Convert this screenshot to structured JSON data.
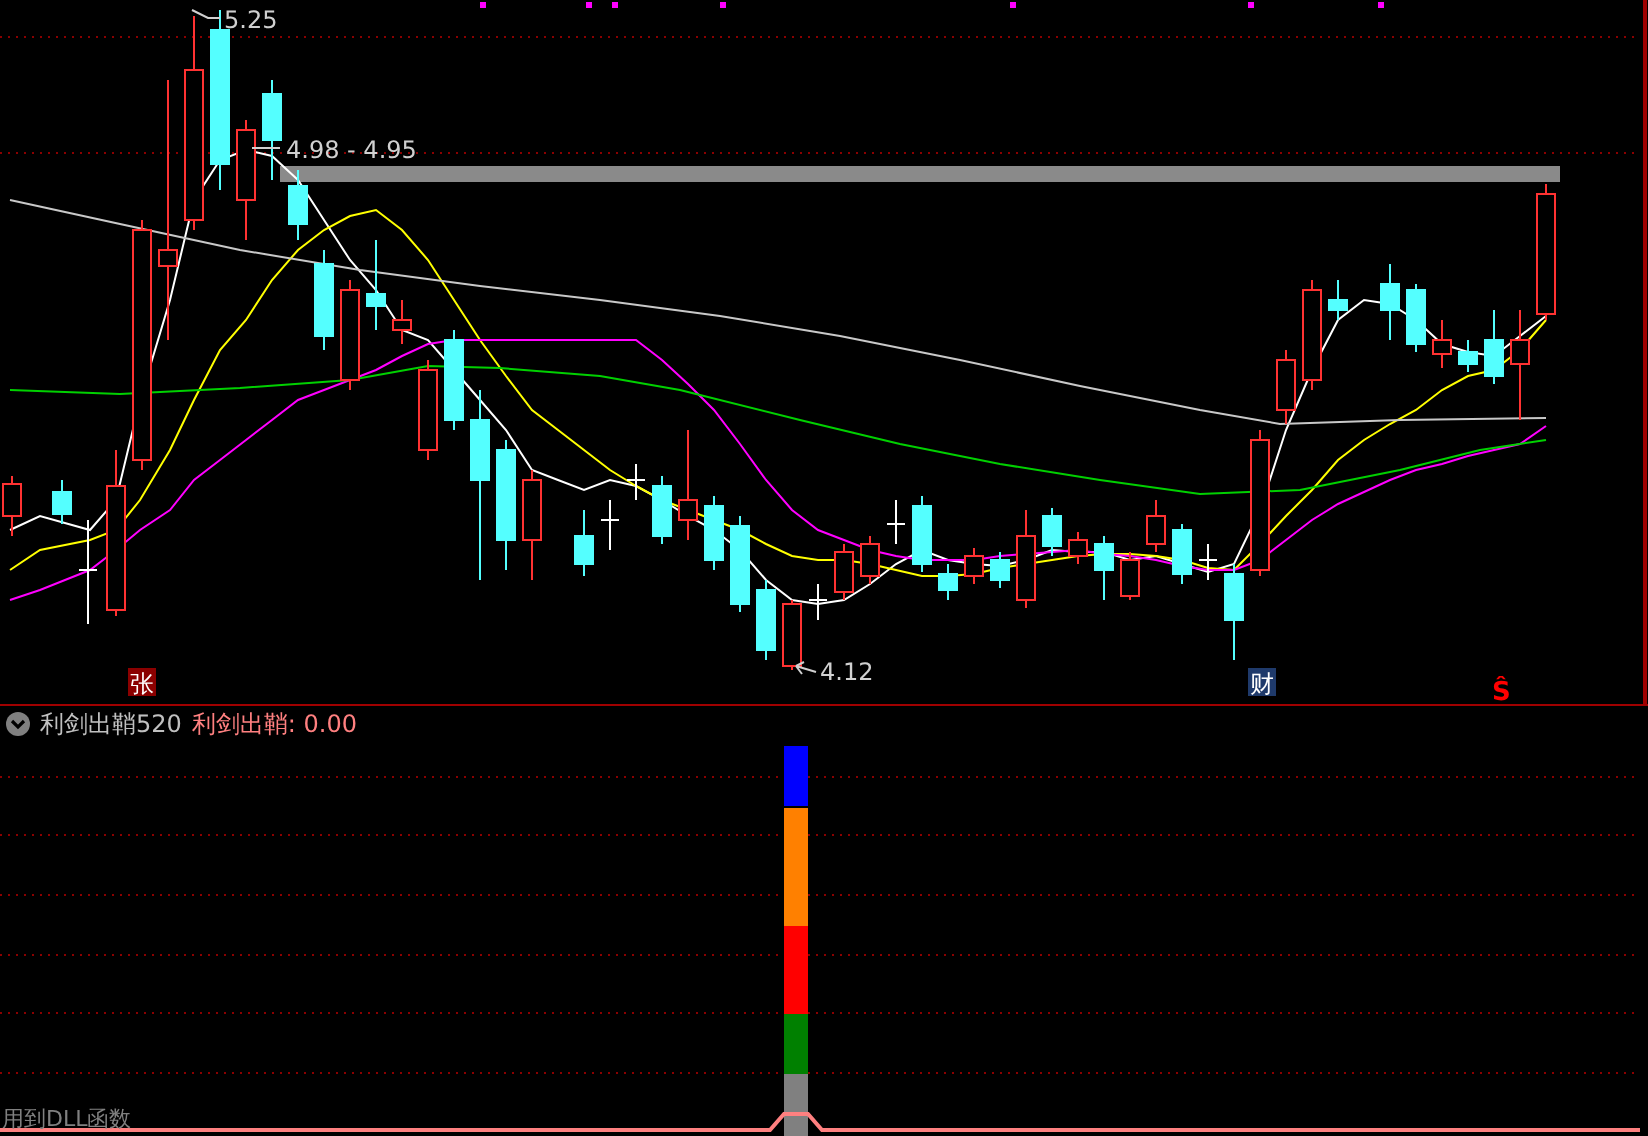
{
  "main_chart": {
    "price_labels": [
      "5.25",
      "4.98 - 4.95",
      "4.12"
    ],
    "markers": [
      {
        "text": "张",
        "kind": "box",
        "color": "#8b0000"
      },
      {
        "text": "财",
        "kind": "box",
        "color": "#1f3a6b"
      },
      {
        "text": "Ŝ",
        "kind": "plain",
        "color": "#ff0000"
      }
    ]
  },
  "indicator": {
    "name": "利剑出鞘520",
    "value_label": "利剑出鞘: 0.00",
    "footer_note": "用到DLL函数"
  }
}
